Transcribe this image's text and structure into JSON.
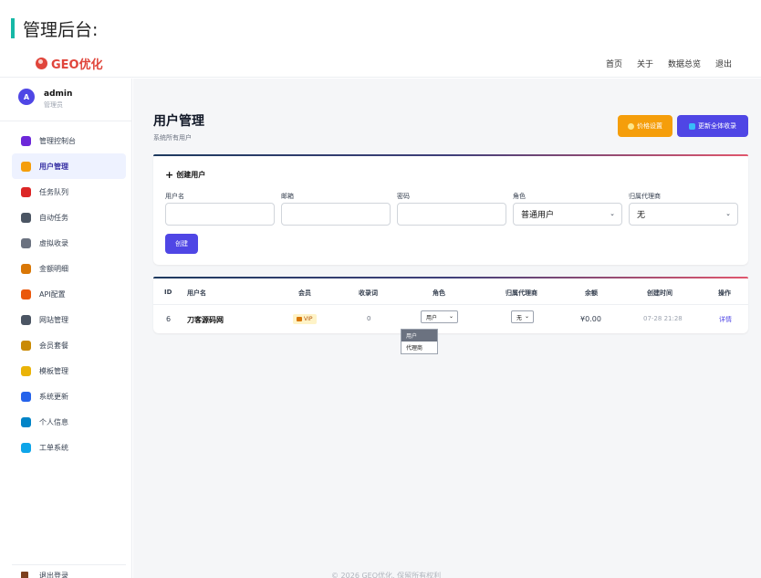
{
  "heading": "管理后台:",
  "brand": {
    "name": "GEO优化"
  },
  "topnav": [
    "首页",
    "关于",
    "数据总览",
    "退出"
  ],
  "user": {
    "avatar": "A",
    "name": "admin",
    "role": "管理员"
  },
  "sidebar": {
    "items": [
      {
        "label": "管理控制台",
        "icon": "dashboard-icon",
        "color": "#6d28d9"
      },
      {
        "label": "用户管理",
        "icon": "users-icon",
        "color": "#f59e0b",
        "active": true
      },
      {
        "label": "任务队列",
        "icon": "queue-icon",
        "color": "#dc2626"
      },
      {
        "label": "自动任务",
        "icon": "gear-icon",
        "color": "#4b5563"
      },
      {
        "label": "虚拟收录",
        "icon": "tag-icon",
        "color": "#6b7280"
      },
      {
        "label": "金额明细",
        "icon": "money-bag-icon",
        "color": "#d97706"
      },
      {
        "label": "API配置",
        "icon": "wrench-icon",
        "color": "#ea580c"
      },
      {
        "label": "网站管理",
        "icon": "globe-icon",
        "color": "#4b5563"
      },
      {
        "label": "会员套餐",
        "icon": "package-icon",
        "color": "#ca8a04"
      },
      {
        "label": "模板管理",
        "icon": "palette-icon",
        "color": "#eab308"
      },
      {
        "label": "系统更新",
        "icon": "refresh-icon",
        "color": "#2563eb"
      },
      {
        "label": "个人信息",
        "icon": "profile-icon",
        "color": "#0284c7"
      },
      {
        "label": "工单系统",
        "icon": "ticket-icon",
        "color": "#0ea5e9"
      }
    ],
    "logout": "退出登录"
  },
  "main": {
    "title": "用户管理",
    "subtitle": "系统所有用户",
    "price_button": "价格设置",
    "update_button": "更新全体收录"
  },
  "create": {
    "title": "创建用户",
    "username_label": "用户名",
    "email_label": "邮箱",
    "password_label": "密码",
    "role_label": "角色",
    "role_value": "普通用户",
    "agent_label": "归属代理商",
    "agent_value": "无",
    "submit": "创建"
  },
  "table": {
    "headers": [
      "ID",
      "用户名",
      "会员",
      "收录词",
      "角色",
      "归属代理商",
      "余额",
      "创建时间",
      "操作"
    ],
    "rows": [
      {
        "id": "6",
        "username": "刀客源码网",
        "member": "VIP",
        "keywords": "0",
        "role": "用户",
        "agent": "无",
        "balance": "¥0.00",
        "created": "07-28 21:28",
        "action": "详情"
      }
    ],
    "role_options": [
      "用户",
      "代理商"
    ]
  },
  "footer": "© 2026 GEO优化. 保留所有权利"
}
